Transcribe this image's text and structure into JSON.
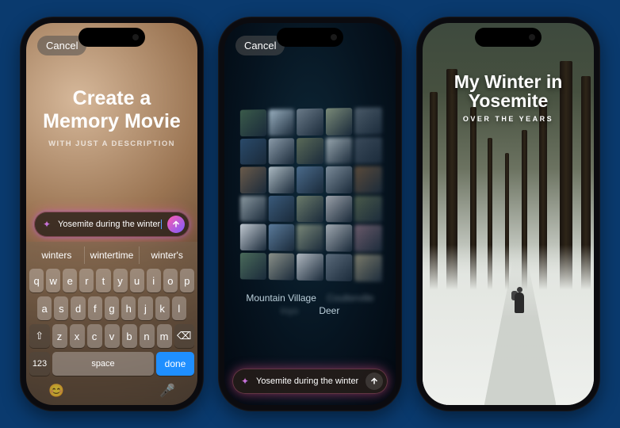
{
  "phone1": {
    "cancel": "Cancel",
    "title_line1": "Create a",
    "title_line2": "Memory Movie",
    "subtitle": "WITH JUST A DESCRIPTION",
    "prompt_value": "Yosemite during the winter",
    "keyboard": {
      "suggestions": [
        "winters",
        "wintertime",
        "winter's"
      ],
      "row1": [
        "q",
        "w",
        "e",
        "r",
        "t",
        "y",
        "u",
        "i",
        "o",
        "p"
      ],
      "row2": [
        "a",
        "s",
        "d",
        "f",
        "g",
        "h",
        "j",
        "k",
        "l"
      ],
      "row3_shift": "⇧",
      "row3": [
        "z",
        "x",
        "c",
        "v",
        "b",
        "n",
        "m"
      ],
      "row3_bksp": "⌫",
      "numbers_key": "123",
      "space_key": "space",
      "done_key": "done",
      "emoji_glyph": "😊",
      "mic_glyph": "🎤"
    }
  },
  "phone2": {
    "cancel": "Cancel",
    "label_row1_a": "Mountain Village",
    "label_row1_b_blurred": "Coulterville",
    "label_row2_a_blurred": "Inyo",
    "label_row2_b": "Deer",
    "prompt_value": "Yosemite during the winter",
    "thumbnail_colors": [
      "#3a5a4a",
      "#9ab0c0",
      "#6a7a88",
      "#7a8a78",
      "#4a5a68",
      "#2a4a6a",
      "#8a9aa8",
      "#5a6a58",
      "#9aa8b0",
      "#3a4a5a",
      "#6a5a4a",
      "#aab8c0",
      "#4a6a8a",
      "#7a8a98",
      "#5a4a3a",
      "#8a98a0",
      "#3a5a7a",
      "#6a7a6a",
      "#9aa0a8",
      "#4a5a4a",
      "#c0c8d0",
      "#5a7a9a",
      "#7a8878",
      "#a0a8b0",
      "#6a5a6a",
      "#4a6a5a",
      "#8a9088",
      "#b0b8c0",
      "#5a6a7a",
      "#7a7a6a"
    ]
  },
  "phone3": {
    "title_line1": "My Winter in",
    "title_line2": "Yosemite",
    "subtitle": "OVER THE YEARS"
  }
}
